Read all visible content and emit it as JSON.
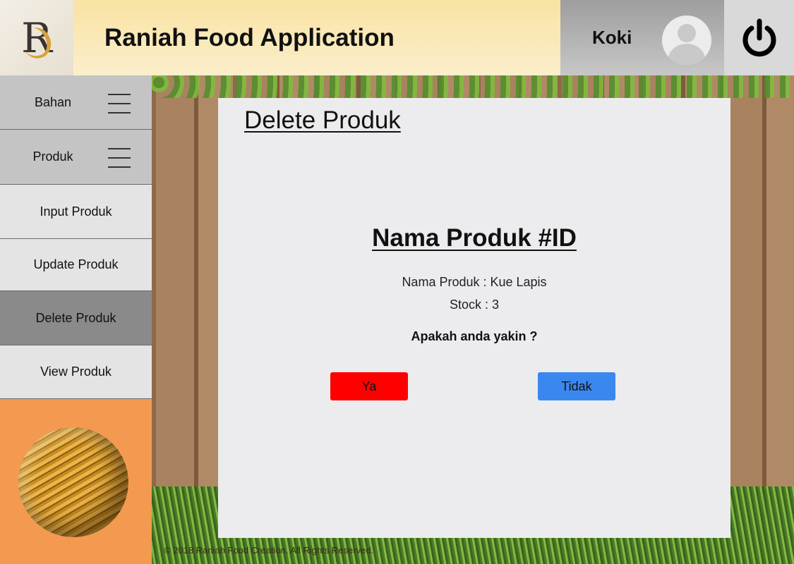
{
  "header": {
    "title": "Raniah Food Application",
    "user_name": "Koki",
    "logo_letter": "R"
  },
  "sidebar": {
    "groups": [
      {
        "label": "Bahan"
      },
      {
        "label": "Produk"
      }
    ],
    "items": [
      {
        "label": "Input Produk"
      },
      {
        "label": "Update Produk"
      },
      {
        "label": "Delete Produk",
        "active": true
      },
      {
        "label": "View Produk"
      }
    ]
  },
  "main": {
    "page_title": "Delete Produk",
    "item_header": "Nama Produk #ID",
    "product_name_line": "Nama Produk : Kue Lapis",
    "stock_line": "Stock : 3",
    "confirm_question": "Apakah anda yakin ?",
    "yes_label": "Ya",
    "no_label": "Tidak"
  },
  "footer": {
    "text": "© 2018 Raniah Food Creation. All Rights Reserved."
  },
  "colors": {
    "yes_button": "#ff0000",
    "no_button": "#3b87f0",
    "header_bg": "#f9e3a3",
    "sidebar_image_bg": "#f49a50",
    "active_menu": "#8a8a8a"
  },
  "icons": [
    "logo-icon",
    "avatar-icon",
    "power-icon",
    "hamburger-icon"
  ]
}
